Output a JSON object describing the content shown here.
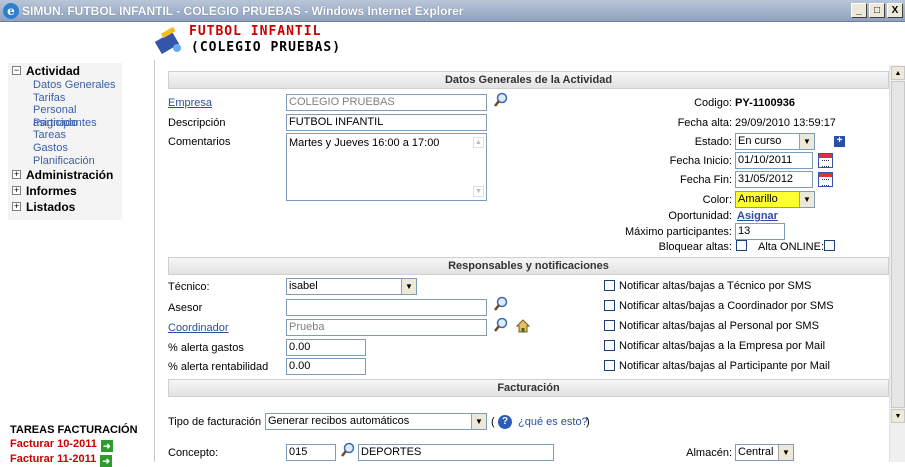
{
  "window": {
    "title": "SIMUN. FUTBOL INFANTIL - COLEGIO PRUEBAS - Windows Internet Explorer",
    "min": "_",
    "max": "□",
    "close": "X"
  },
  "header": {
    "title": "FUTBOL INFANTIL",
    "subtitle": "(COLEGIO PRUEBAS)"
  },
  "sidebar": {
    "tree": [
      {
        "label": "Actividad",
        "toggle": "−",
        "children": [
          "Datos Generales",
          "Tarifas",
          "Personal asignado",
          "Participantes",
          "Tareas",
          "Gastos",
          "Planificación"
        ]
      },
      {
        "label": "Administración",
        "toggle": "+"
      },
      {
        "label": "Informes",
        "toggle": "+"
      },
      {
        "label": "Listados",
        "toggle": "+"
      }
    ],
    "tasks_title": "TAREAS FACTURACIÓN",
    "tasks": [
      "Facturar 10-2011",
      "Facturar 11-2011"
    ]
  },
  "general": {
    "header": "Datos Generales de la Actividad",
    "empresa_label": "Empresa",
    "empresa_value": "COLEGIO PRUEBAS",
    "descripcion_label": "Descripción",
    "descripcion_value": "FUTBOL INFANTIL",
    "comentarios_label": "Comentarios",
    "comentarios_value": "Martes y Jueves 16:00 a 17:00",
    "codigo_label": "Codigo:",
    "codigo_value": "PY-1100936",
    "fecha_alta_label": "Fecha alta:",
    "fecha_alta_value": "29/09/2010 13:59:17",
    "estado_label": "Estado:",
    "estado_value": "En curso",
    "fecha_inicio_label": "Fecha Inicio:",
    "fecha_inicio_value": "01/10/2011",
    "fecha_fin_label": "Fecha Fin:",
    "fecha_fin_value": "31/05/2012",
    "color_label": "Color:",
    "color_value": "Amarillo",
    "oportunidad_label": "Oportunidad:",
    "oportunidad_link": "Asignar",
    "max_part_label": "Máximo participantes:",
    "max_part_value": "13",
    "bloquear_label": "Bloquear altas:",
    "alta_online_label": "Alta ONLINE:"
  },
  "responsables": {
    "header": "Responsables y notificaciones",
    "tecnico_label": "Técnico:",
    "tecnico_value": "isabel",
    "asesor_label": "Asesor",
    "asesor_value": "",
    "coordinador_label": "Coordinador",
    "coordinador_value": "Prueba",
    "alerta_gastos_label": "% alerta gastos",
    "alerta_gastos_value": "0.00",
    "alerta_rent_label": "% alerta rentabilidad",
    "alerta_rent_value": "0.00",
    "notificaciones": [
      "Notificar altas/bajas a Técnico por SMS",
      "Notificar altas/bajas a Coordinador por SMS",
      "Notificar altas/bajas al Personal por SMS",
      "Notificar altas/bajas a la Empresa por Mail",
      "Notificar altas/bajas al Participante por Mail"
    ]
  },
  "facturacion": {
    "header": "Facturación",
    "tipo_label": "Tipo de facturación",
    "tipo_value": "Generar recibos automáticos",
    "help_open": "(",
    "help_link": "¿qué es esto?",
    "help_close": ")",
    "concepto_label": "Concepto:",
    "concepto_code": "015",
    "concepto_value": "DEPORTES",
    "almacen_label": "Almacén:",
    "almacen_value": "Central"
  },
  "colors": {
    "accent_red": "#cc0000",
    "link_blue": "#2b4f9e",
    "highlight_yellow": "#ffff33"
  }
}
